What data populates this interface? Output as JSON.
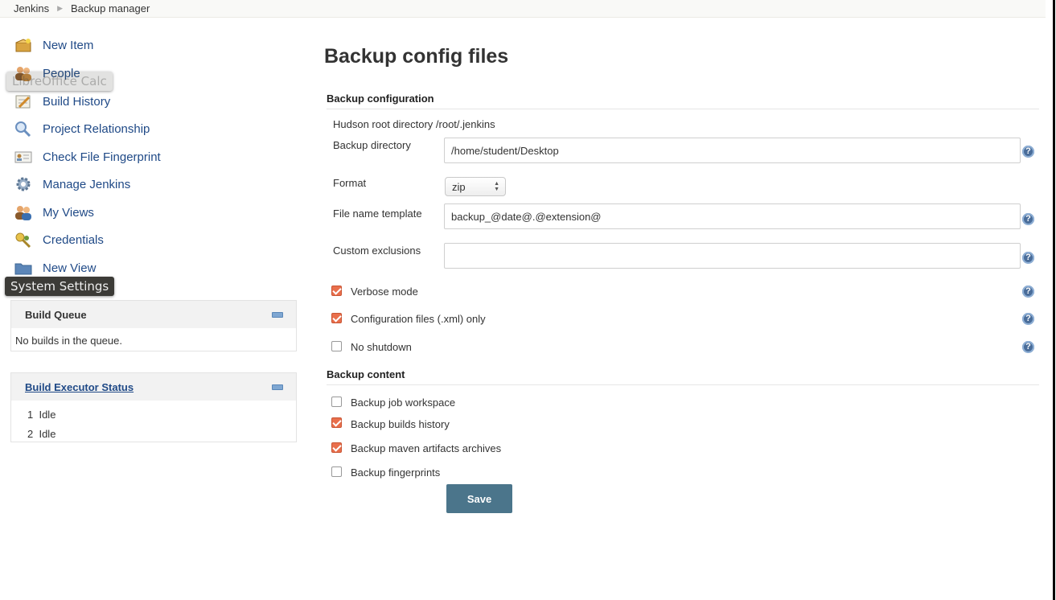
{
  "breadcrumb": [
    "Jenkins",
    "Backup manager"
  ],
  "tasks": [
    {
      "label": "New Item",
      "icon": "new-item-icon"
    },
    {
      "label": "People",
      "icon": "people-icon"
    },
    {
      "label": "Build History",
      "icon": "notepad-icon"
    },
    {
      "label": "Project Relationship",
      "icon": "search-icon"
    },
    {
      "label": "Check File Fingerprint",
      "icon": "fingerprint-card-icon"
    },
    {
      "label": "Manage Jenkins",
      "icon": "gear-icon"
    },
    {
      "label": "My Views",
      "icon": "people-icon"
    },
    {
      "label": "Credentials",
      "icon": "key-icon"
    },
    {
      "label": "New View",
      "icon": "folder-icon"
    }
  ],
  "tooltips": {
    "calc": "LibreOffice Calc",
    "settings": "System Settings"
  },
  "build_queue": {
    "title": "Build Queue",
    "empty_text": "No builds in the queue."
  },
  "executor_status": {
    "title": "Build Executor Status",
    "executors": [
      {
        "num": "1",
        "state": "Idle"
      },
      {
        "num": "2",
        "state": "Idle"
      }
    ]
  },
  "main": {
    "title": "Backup config files",
    "section_config": "Backup configuration",
    "hudson_root_label": "Hudson root directory",
    "hudson_root_value": "/root/.jenkins",
    "backup_dir_label": "Backup directory",
    "backup_dir_value": "/home/student/Desktop",
    "format_label": "Format",
    "format_value": "zip",
    "filename_label": "File name template",
    "filename_value": "backup_@date@.@extension@",
    "exclusions_label": "Custom exclusions",
    "exclusions_value": "",
    "help_symbol": "?",
    "verbose_label": "Verbose mode",
    "verbose_checked": true,
    "config_only_label": "Configuration files (.xml) only",
    "config_only_checked": true,
    "no_shutdown_label": "No shutdown",
    "no_shutdown_checked": false,
    "section_content": "Backup content",
    "content_options": [
      {
        "label": "Backup job workspace",
        "checked": false
      },
      {
        "label": "Backup builds history",
        "checked": true
      },
      {
        "label": "Backup maven artifacts archives",
        "checked": true
      },
      {
        "label": "Backup fingerprints",
        "checked": false
      }
    ],
    "save_label": "Save"
  },
  "colors": {
    "link": "#204a87",
    "checkbox_checked": "#e96f4c",
    "save_button": "#4b758b"
  }
}
